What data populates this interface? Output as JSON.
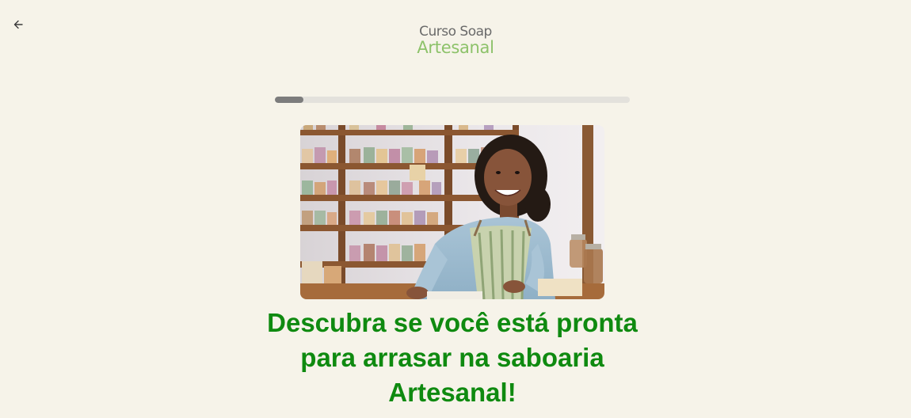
{
  "header": {
    "back_icon": "arrow-left-icon",
    "logo": {
      "line1": "Curso Soap",
      "line2": "Artesanal"
    }
  },
  "progress": {
    "value": 0.08
  },
  "hero_image": {
    "subject": "smiling-woman-soap-shop-photo"
  },
  "main": {
    "headline": "Descubra se você está pronta para arrasar na saboaria Artesanal!"
  },
  "colors": {
    "background": "#f6f3e9",
    "headline": "#0f8a10",
    "logo_accent": "#8dc26a",
    "progress_fill": "#7c7c7c",
    "progress_track": "#e3e1dc"
  }
}
